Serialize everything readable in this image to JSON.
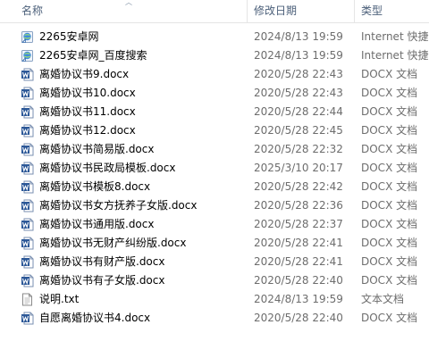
{
  "columns": {
    "name": "名称",
    "date": "修改日期",
    "type": "类型"
  },
  "files": [
    {
      "name": "2265安卓网",
      "date": "2024/8/13 19:59",
      "type": "Internet 快捷方式",
      "icon": "internet-shortcut-icon"
    },
    {
      "name": "2265安卓网_百度搜索",
      "date": "2024/8/13 19:59",
      "type": "Internet 快捷方式",
      "icon": "internet-shortcut-icon"
    },
    {
      "name": "离婚协议书9.docx",
      "date": "2020/5/28 22:43",
      "type": "DOCX 文档",
      "icon": "word-document-icon"
    },
    {
      "name": "离婚协议书10.docx",
      "date": "2020/5/28 22:43",
      "type": "DOCX 文档",
      "icon": "word-document-icon"
    },
    {
      "name": "离婚协议书11.docx",
      "date": "2020/5/28 22:44",
      "type": "DOCX 文档",
      "icon": "word-document-icon"
    },
    {
      "name": "离婚协议书12.docx",
      "date": "2020/5/28 22:45",
      "type": "DOCX 文档",
      "icon": "word-document-icon"
    },
    {
      "name": "离婚协议书简易版.docx",
      "date": "2020/5/28 22:32",
      "type": "DOCX 文档",
      "icon": "word-document-icon"
    },
    {
      "name": "离婚协议书民政局模板.docx",
      "date": "2025/3/10 20:17",
      "type": "DOCX 文档",
      "icon": "word-document-icon"
    },
    {
      "name": "离婚协议书模板8.docx",
      "date": "2020/5/28 22:42",
      "type": "DOCX 文档",
      "icon": "word-document-icon"
    },
    {
      "name": "离婚协议书女方抚养子女版.docx",
      "date": "2020/5/28 22:36",
      "type": "DOCX 文档",
      "icon": "word-document-icon"
    },
    {
      "name": "离婚协议书通用版.docx",
      "date": "2020/5/28 22:37",
      "type": "DOCX 文档",
      "icon": "word-document-icon"
    },
    {
      "name": "离婚协议书无财产纠纷版.docx",
      "date": "2020/5/28 22:41",
      "type": "DOCX 文档",
      "icon": "word-document-icon"
    },
    {
      "name": "离婚协议书有财产版.docx",
      "date": "2020/5/28 22:41",
      "type": "DOCX 文档",
      "icon": "word-document-icon"
    },
    {
      "name": "离婚协议书有子女版.docx",
      "date": "2020/5/28 22:40",
      "type": "DOCX 文档",
      "icon": "word-document-icon"
    },
    {
      "name": "说明.txt",
      "date": "2024/8/13 19:59",
      "type": "文本文档",
      "icon": "text-file-icon"
    },
    {
      "name": "自愿离婚协议书4.docx",
      "date": "2020/5/28 22:40",
      "type": "DOCX 文档",
      "icon": "word-document-icon"
    }
  ],
  "colors": {
    "header_text": "#4c607a",
    "secondary_text": "#6d6d6d",
    "word_blue": "#2b5797"
  }
}
